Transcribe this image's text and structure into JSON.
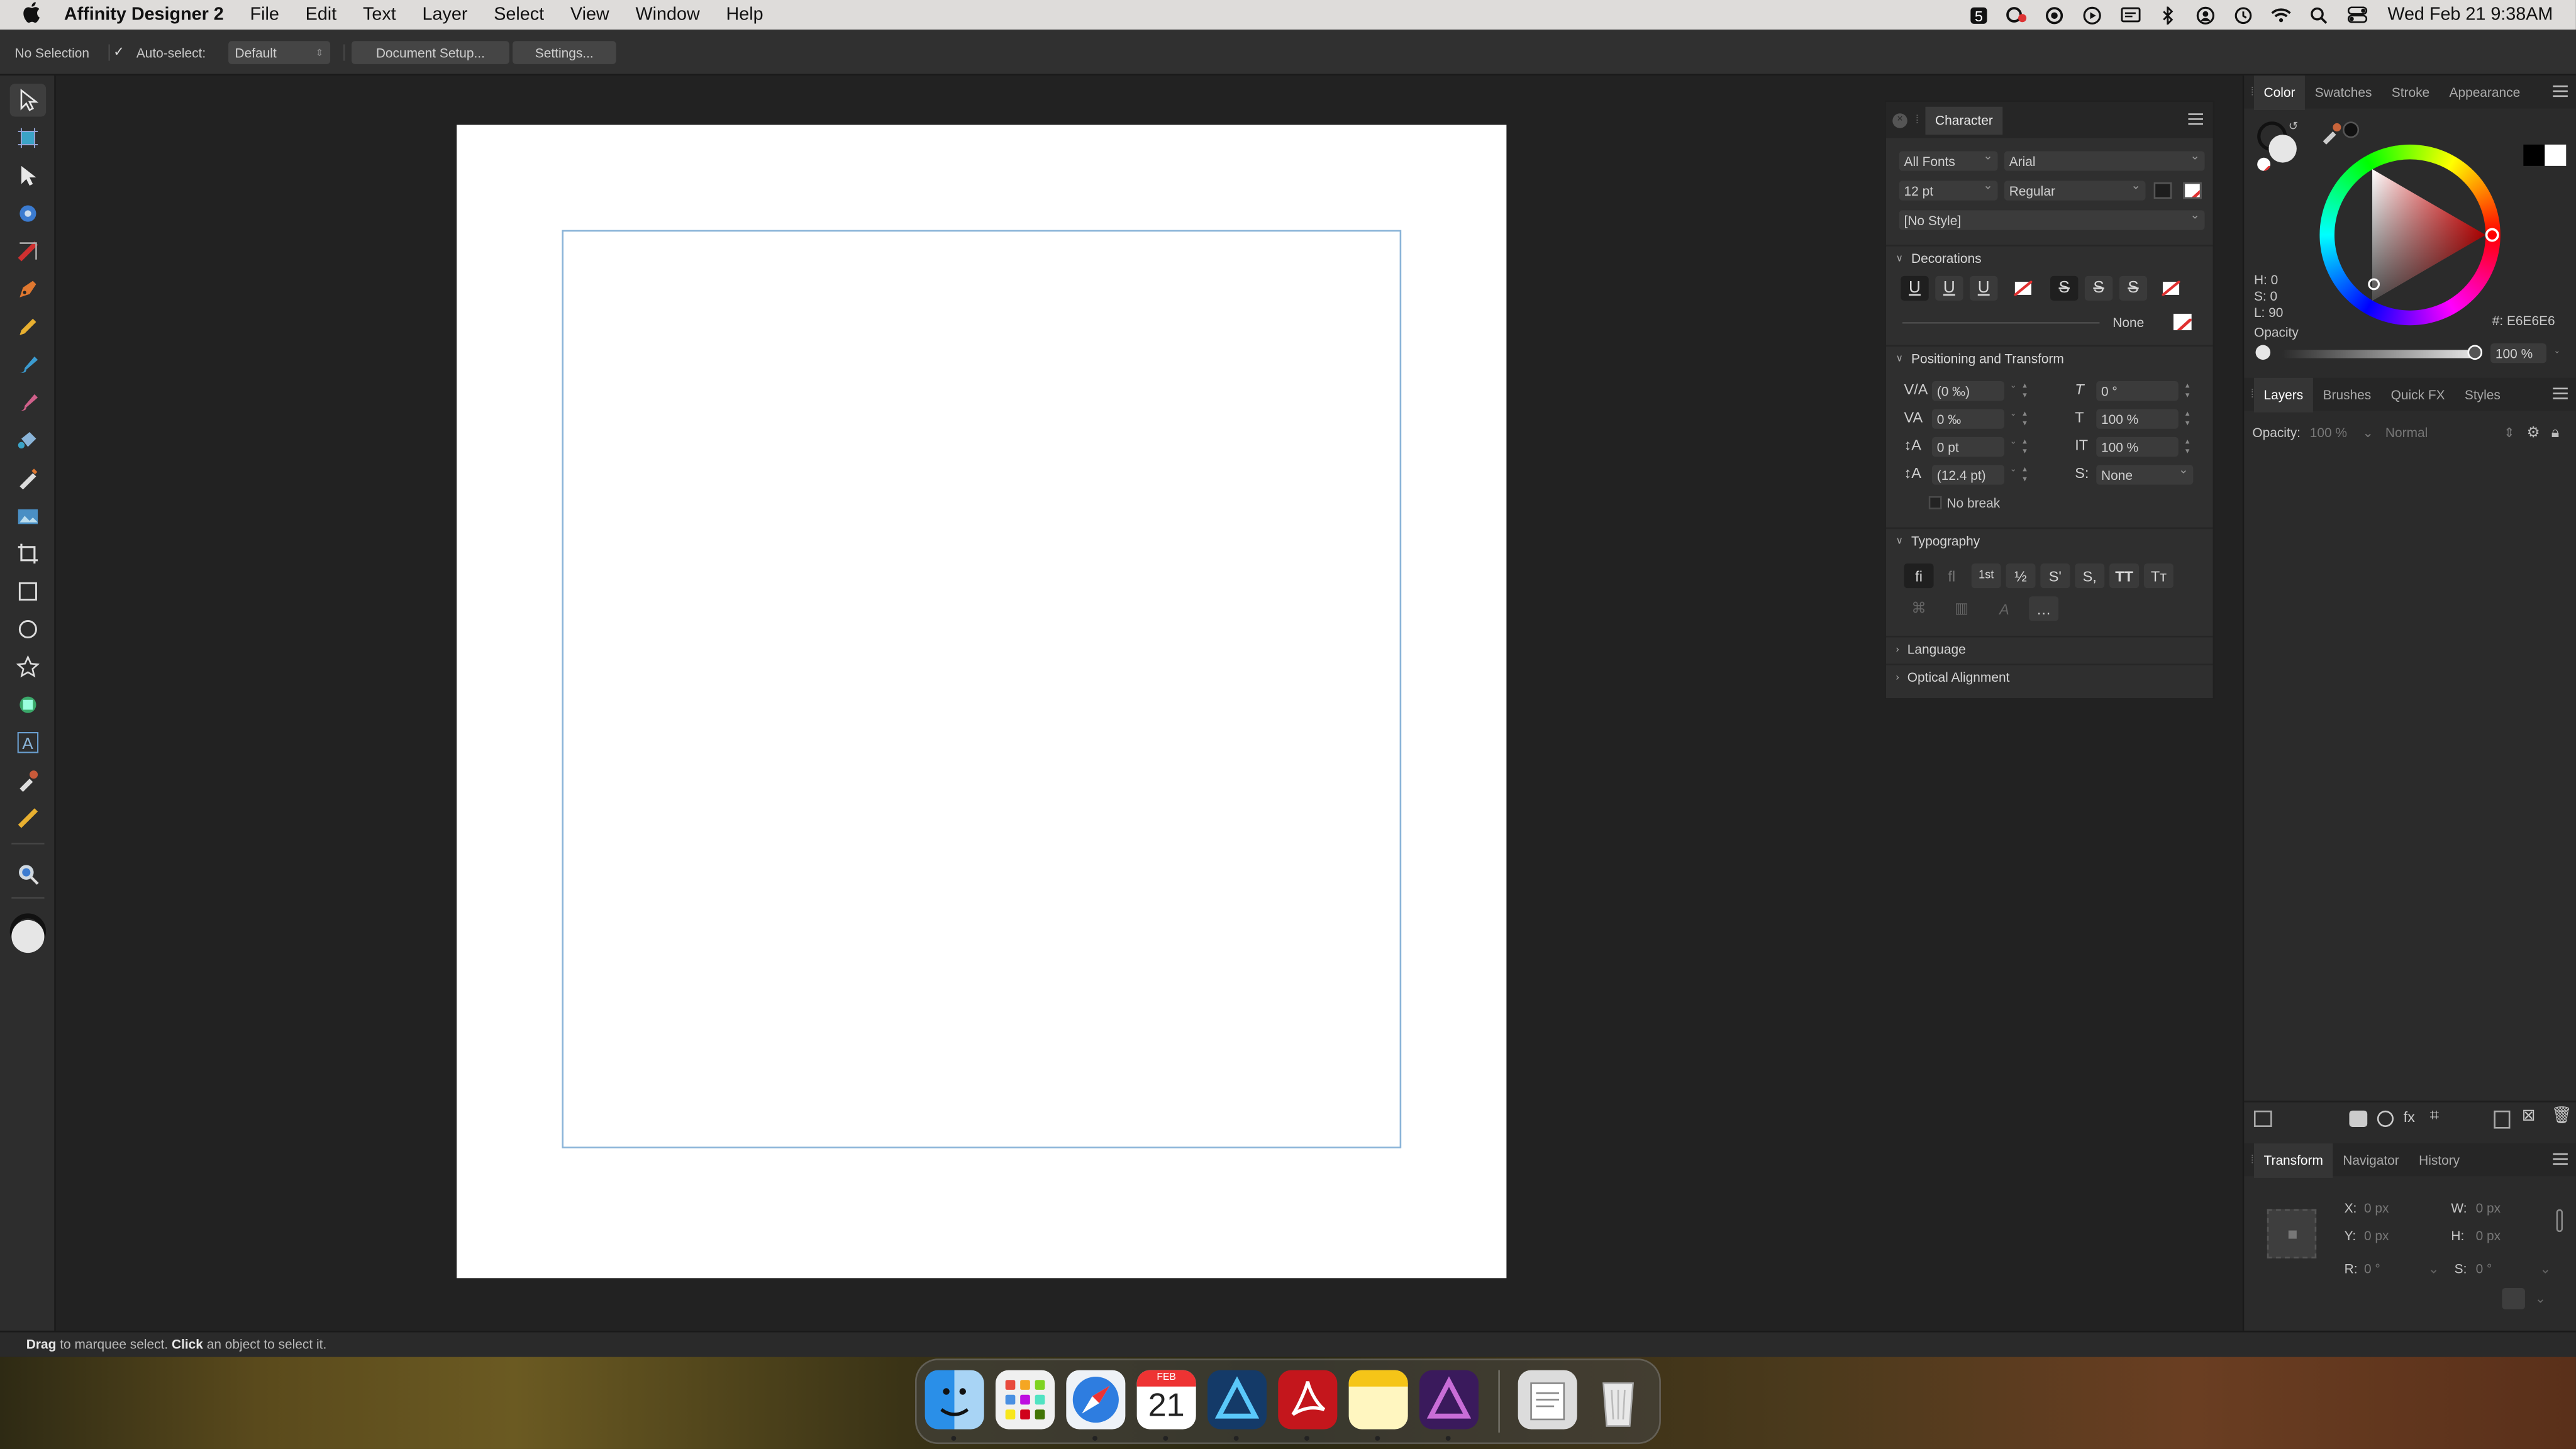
{
  "menubar": {
    "app_name": "Affinity Designer 2",
    "menus": [
      "File",
      "Edit",
      "Text",
      "Layer",
      "Select",
      "View",
      "Window",
      "Help"
    ],
    "clock": "Wed Feb 21  9:38AM",
    "status_icons": [
      "five-icon",
      "creative-cloud-icon",
      "screen-record-icon",
      "play-icon",
      "display-icon",
      "bluetooth-icon",
      "user-icon",
      "time-machine-icon",
      "wifi-icon",
      "spotlight-icon",
      "control-center-icon"
    ]
  },
  "context_bar": {
    "selection": "No Selection",
    "auto_select_label": "Auto-select:",
    "auto_select_value": "Default",
    "doc_setup": "Document Setup...",
    "settings": "Settings..."
  },
  "tools": [
    "move-tool-icon",
    "artboard-tool-icon",
    "node-tool-icon",
    "corner-tool-icon",
    "point-transform-tool-icon",
    "pen-tool-icon",
    "pencil-tool-icon",
    "vector-brush-tool-icon",
    "paint-brush-tool-icon",
    "fill-tool-icon",
    "transparency-tool-icon",
    "place-image-tool-icon",
    "crop-tool-icon",
    "rectangle-tool-icon",
    "ellipse-tool-icon",
    "star-tool-icon",
    "shape-tool-icon",
    "artistic-text-tool-icon",
    "color-picker-tool-icon",
    "measure-tool-icon",
    "view-tool-icon",
    "fill-stroke-well-icon"
  ],
  "status_bar": {
    "drag": "Drag",
    "drag_text": " to marquee select. ",
    "click": "Click",
    "click_text": " an object to select it."
  },
  "character": {
    "title": "Character",
    "font_collection": "All Fonts",
    "font": "Arial",
    "size": "12 pt",
    "weight": "Regular",
    "style": "[No Style]",
    "decorations": "Decorations",
    "deco_none": "None",
    "positioning": "Positioning and Transform",
    "kerning": "(0 ‰)",
    "tracking": "0 ‰",
    "baseline": "0 pt",
    "leading": "(12.4 pt)",
    "shear": "0 °",
    "vscale": "100 %",
    "hscale": "100 %",
    "script": "None",
    "no_break": "No break",
    "typography": "Typography",
    "language": "Language",
    "optical": "Optical Alignment",
    "typo_row1": [
      "fi",
      "ﬂ",
      "1st",
      "½",
      "S'",
      "S,",
      "TT",
      "Tт"
    ],
    "typo_row2": [
      "…"
    ]
  },
  "color_panel": {
    "tabs": [
      "Color",
      "Swatches",
      "Stroke",
      "Appearance"
    ],
    "h": "H: 0",
    "s": "S: 0",
    "l": "L: 90",
    "hex": "#: E6E6E6",
    "opacity_label": "Opacity",
    "opacity_value": "100 %",
    "accent": "#e6e6e6"
  },
  "layers_panel": {
    "tabs": [
      "Layers",
      "Brushes",
      "Quick FX",
      "Styles"
    ],
    "opacity_label": "Opacity:",
    "opacity_value": "100 %",
    "blend": "Normal"
  },
  "transform_panel": {
    "tabs": [
      "Transform",
      "Navigator",
      "History"
    ],
    "x_label": "X:",
    "x": "0 px",
    "y_label": "Y:",
    "y": "0 px",
    "w_label": "W:",
    "w": "0 px",
    "h_label": "H:",
    "h": "0 px",
    "r_label": "R:",
    "r": "0 °",
    "s_label": "S:",
    "s": "0 °"
  },
  "dock": {
    "apps": [
      "finder-icon",
      "launchpad-icon",
      "safari-icon",
      "calendar-icon",
      "affinity-designer-icon",
      "acrobat-icon",
      "notes-icon",
      "affinity-photo-icon",
      "documents-icon",
      "trash-icon"
    ],
    "calendar_month": "FEB",
    "calendar_day": "21"
  }
}
